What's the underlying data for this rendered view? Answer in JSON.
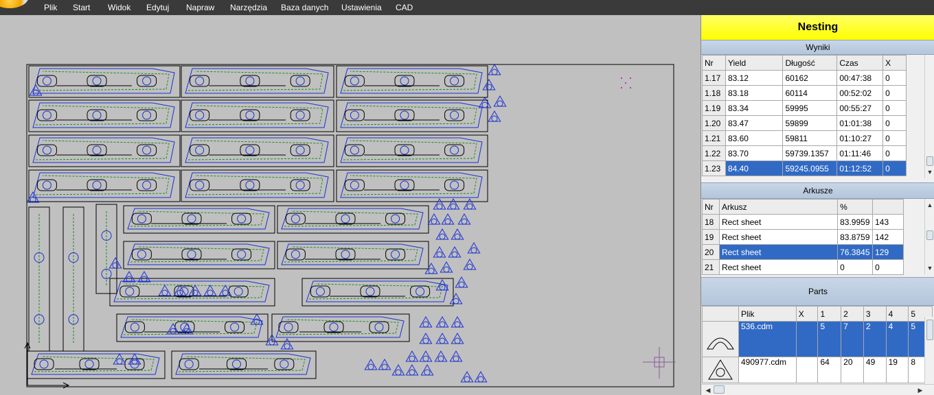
{
  "menu": {
    "items": [
      "Plik",
      "Start",
      "Widok",
      "Edytuj",
      "Napraw",
      "Narzędzia",
      "Baza danych",
      "Ustawienia",
      "CAD"
    ]
  },
  "panel": {
    "title": "Nesting",
    "results": {
      "header": "Wyniki",
      "columns": [
        "Nr",
        "Yield",
        "Długość",
        "Czas",
        "X"
      ],
      "rows": [
        {
          "nr": "1.17",
          "yield": "83.12",
          "dlugosc": "60162",
          "czas": "00:47:38",
          "x": "0"
        },
        {
          "nr": "1.18",
          "yield": "83.18",
          "dlugosc": "60114",
          "czas": "00:52:02",
          "x": "0"
        },
        {
          "nr": "1.19",
          "yield": "83.34",
          "dlugosc": "59995",
          "czas": "00:55:27",
          "x": "0"
        },
        {
          "nr": "1.20",
          "yield": "83.47",
          "dlugosc": "59899",
          "czas": "01:01:38",
          "x": "0"
        },
        {
          "nr": "1.21",
          "yield": "83.60",
          "dlugosc": "59811",
          "czas": "01:10:27",
          "x": "0"
        },
        {
          "nr": "1.22",
          "yield": "83.70",
          "dlugosc": "59739.1357",
          "czas": "01:11:46",
          "x": "0"
        },
        {
          "nr": "1.23",
          "yield": "84.40",
          "dlugosc": "59245.0955",
          "czas": "01:12:52",
          "x": "0"
        }
      ],
      "selected_index": 6
    },
    "sheets": {
      "header": "Arkusze",
      "columns": [
        "Nr",
        "Arkusz",
        "%",
        ""
      ],
      "rows": [
        {
          "nr": "18",
          "arkusz": "Rect sheet",
          "pct": "83.9959",
          "count": "143"
        },
        {
          "nr": "19",
          "arkusz": "Rect sheet",
          "pct": "83.8759",
          "count": "142"
        },
        {
          "nr": "20",
          "arkusz": "Rect sheet",
          "pct": "76.3845",
          "count": "129"
        },
        {
          "nr": "21",
          "arkusz": "Rect sheet",
          "pct": "0",
          "count": "0"
        }
      ],
      "selected_index": 2
    },
    "parts": {
      "header": "Parts",
      "columns": [
        "Plik",
        "X",
        "1",
        "2",
        "3",
        "4",
        "5"
      ],
      "rows": [
        {
          "plik": "536.cdm",
          "x": "",
          "c1": "5",
          "c2": "7",
          "c3": "2",
          "c4": "4",
          "c5": "5"
        },
        {
          "plik": "490977.cdm",
          "x": "",
          "c1": "64",
          "c2": "20",
          "c3": "49",
          "c4": "19",
          "c5": "8"
        }
      ],
      "selected_index": 0
    }
  },
  "colors": {
    "accent_selected": "#316ac5",
    "part_outline": "#1a2fd4",
    "toolpath": "#1c8a1c",
    "sheet_outline": "#000000",
    "nesting_title_bg": "#ffff00"
  },
  "icons": [
    "app-orb-icon",
    "crosshair-icon",
    "sheet-origin-arrow-icon",
    "scroll-up-icon",
    "scroll-down-icon",
    "scroll-left-icon",
    "scroll-right-icon"
  ]
}
